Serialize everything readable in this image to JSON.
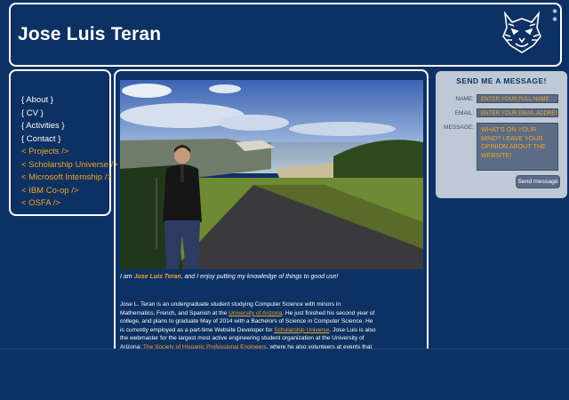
{
  "header": {
    "title": "Jose Luis Teran",
    "logo_icon": "wildcat-logo-icon"
  },
  "nav": {
    "items": [
      {
        "label": "{ About }",
        "color": "#ffffff"
      },
      {
        "label": "{ CV }",
        "color": "#ffffff"
      },
      {
        "label": "{ Activities }",
        "color": "#ffffff"
      },
      {
        "label": "{ Contact }",
        "color": "#ffffff"
      },
      {
        "label": "< Projects />",
        "color": "#f5a321"
      },
      {
        "label": "< Scholarship Universe />",
        "color": "#f5a321"
      },
      {
        "label": "< Microsoft Internship />",
        "color": "#f5a321"
      },
      {
        "label": "< IBM Co-op />",
        "color": "#f5a321"
      },
      {
        "label": "< OSFA />",
        "color": "#f5a321"
      }
    ]
  },
  "main": {
    "caption_prefix": "I am ",
    "caption_name": "Jose Luis Teran",
    "caption_suffix": ", and I enjoy putting my knowledge of things to good use!",
    "bio": {
      "t1": "Jose L. Teran is an undergraduate student studying Computer Science with minors in Mathematics, French, and Spanish at the ",
      "l1": "University of Arizona",
      "t2": ". He just finished his second year of college, and plans to graduate May of 2014 with a Bachelors of Science in Computer Science. He is currently employed as a part-time Website Developer for ",
      "l2": "Scholarship Universe",
      "t3": ". Jose Luis is also the webmaster for the largest most active engineering student organization at the University of Arizona: ",
      "l3": "The Society of Hispanic Professional Engineers",
      "t4": ", where he also volunteers at events that help reach out to the"
    }
  },
  "contact": {
    "title": "SEND ME A MESSAGE!",
    "name_label": "NAME:",
    "name_placeholder": "ENTER YOUR FULL NAME",
    "email_label": "EMAIL:",
    "email_placeholder": "ENTER YOUR EMAIL ADDRESS",
    "message_label": "MESSAGE:",
    "message_placeholder": "WHAT'S ON YOUR MIND? LEAVE YOUR OPINION ABOUT THE WEBSITE!",
    "send_label": "Send message"
  },
  "colors": {
    "background": "#0d3163",
    "accent": "#f5a321",
    "panel": "#bfc9d5"
  }
}
